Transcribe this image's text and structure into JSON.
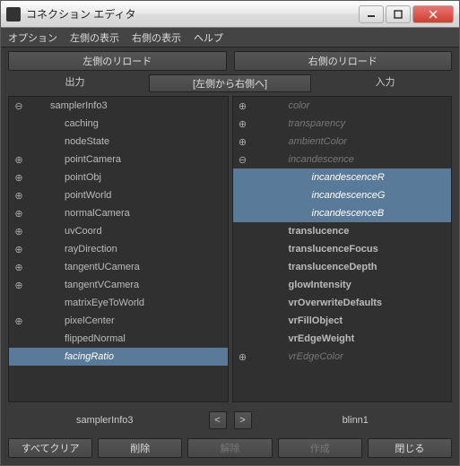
{
  "window": {
    "title": "コネクション エディタ"
  },
  "menu": {
    "options": "オプション",
    "left_display": "左側の表示",
    "right_display": "右側の表示",
    "help": "ヘルプ"
  },
  "toolbar": {
    "reload_left": "左側のリロード",
    "reload_right": "右側のリロード"
  },
  "headers": {
    "outputs": "出力",
    "direction": "[左側から右側へ]",
    "inputs": "入力"
  },
  "left": {
    "root": "samplerInfo3",
    "attrs": [
      {
        "name": "caching",
        "exp": "",
        "style": "normal"
      },
      {
        "name": "nodeState",
        "exp": "",
        "style": "normal"
      },
      {
        "name": "pointCamera",
        "exp": "⊕",
        "style": "normal"
      },
      {
        "name": "pointObj",
        "exp": "⊕",
        "style": "normal"
      },
      {
        "name": "pointWorld",
        "exp": "⊕",
        "style": "normal"
      },
      {
        "name": "normalCamera",
        "exp": "⊕",
        "style": "normal"
      },
      {
        "name": "uvCoord",
        "exp": "⊕",
        "style": "normal"
      },
      {
        "name": "rayDirection",
        "exp": "⊕",
        "style": "normal"
      },
      {
        "name": "tangentUCamera",
        "exp": "⊕",
        "style": "normal"
      },
      {
        "name": "tangentVCamera",
        "exp": "⊕",
        "style": "normal"
      },
      {
        "name": "matrixEyeToWorld",
        "exp": "",
        "style": "normal"
      },
      {
        "name": "pixelCenter",
        "exp": "⊕",
        "style": "normal"
      },
      {
        "name": "flippedNormal",
        "exp": "",
        "style": "normal"
      },
      {
        "name": "facingRatio",
        "exp": "",
        "style": "selected italic"
      }
    ]
  },
  "right": {
    "root_attrs": [
      {
        "name": "color",
        "exp": "⊕",
        "style": "dim"
      },
      {
        "name": "transparency",
        "exp": "⊕",
        "style": "dim"
      },
      {
        "name": "ambientColor",
        "exp": "⊕",
        "style": "dim"
      },
      {
        "name": "incandescence",
        "exp": "⊖",
        "style": "dim"
      }
    ],
    "incand_children": [
      {
        "name": "incandescenceR",
        "style": "selected italic"
      },
      {
        "name": "incandescenceG",
        "style": "selected italic"
      },
      {
        "name": "incandescenceB",
        "style": "selected italic"
      }
    ],
    "after_attrs": [
      {
        "name": "translucence",
        "exp": "",
        "style": "bold"
      },
      {
        "name": "translucenceFocus",
        "exp": "",
        "style": "bold"
      },
      {
        "name": "translucenceDepth",
        "exp": "",
        "style": "bold"
      },
      {
        "name": "glowIntensity",
        "exp": "",
        "style": "bold"
      },
      {
        "name": "vrOverwriteDefaults",
        "exp": "",
        "style": "bold"
      },
      {
        "name": "vrFillObject",
        "exp": "",
        "style": "bold"
      },
      {
        "name": "vrEdgeWeight",
        "exp": "",
        "style": "bold"
      },
      {
        "name": "vrEdgeColor",
        "exp": "⊕",
        "style": "dim"
      }
    ]
  },
  "footer": {
    "left_node": "samplerInfo3",
    "right_node": "blinn1",
    "prev": "<",
    "next": ">"
  },
  "actions": {
    "clear_all": "すべてクリア",
    "delete": "削除",
    "break": "解除",
    "make": "作成",
    "close": "閉じる"
  }
}
